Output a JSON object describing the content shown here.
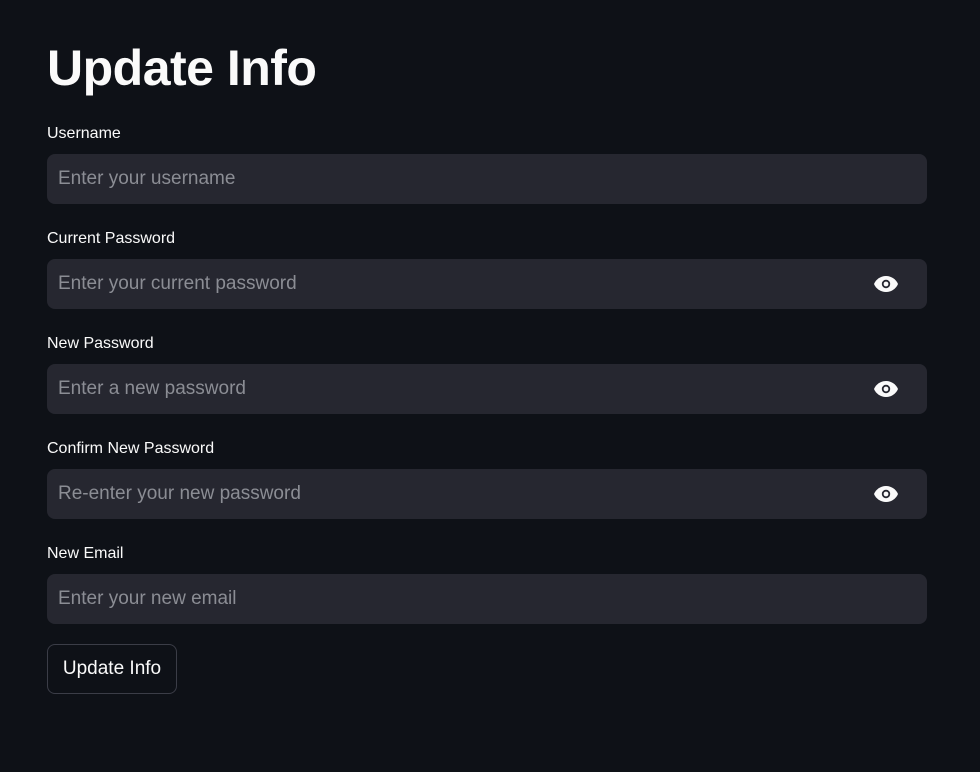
{
  "page": {
    "title": "Update Info"
  },
  "form": {
    "username": {
      "label": "Username",
      "placeholder": "Enter your username",
      "value": ""
    },
    "current_password": {
      "label": "Current Password",
      "placeholder": "Enter your current password",
      "value": "",
      "toggle_icon": "eye-icon"
    },
    "new_password": {
      "label": "New Password",
      "placeholder": "Enter a new password",
      "value": "",
      "toggle_icon": "eye-icon"
    },
    "confirm_password": {
      "label": "Confirm New Password",
      "placeholder": "Re-enter your new password",
      "value": "",
      "toggle_icon": "eye-icon"
    },
    "new_email": {
      "label": "New Email",
      "placeholder": "Enter your new email",
      "value": ""
    },
    "submit_label": "Update Info"
  },
  "colors": {
    "background": "#0e1117",
    "input_background": "#262730",
    "text": "#fafafa",
    "placeholder": "#8b8d94",
    "button_border": "#3b3d47"
  }
}
